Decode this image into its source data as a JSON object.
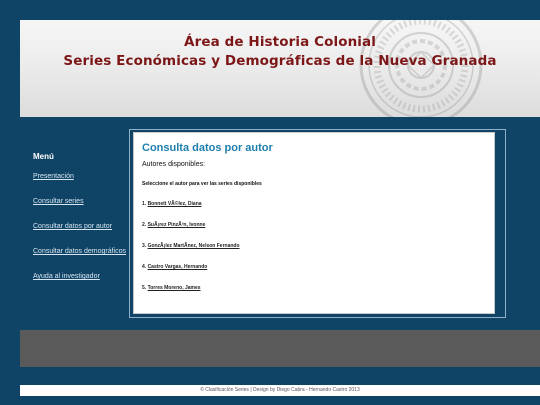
{
  "header": {
    "title_line1": "Área de Historia Colonial",
    "title_line2": "Series Económicas y Demográficas de la Nueva Granada"
  },
  "sidebar": {
    "title": "Menú",
    "items": [
      {
        "label": "Presentación"
      },
      {
        "label": "Consultar series"
      },
      {
        "label": "Consultar datos por autor"
      },
      {
        "label": "Consultar datos demográficos"
      },
      {
        "label": "Ayuda al investigador"
      }
    ]
  },
  "content": {
    "title": "Consulta datos por autor",
    "authors_label": "Autores disponibles:",
    "instruction": "Seleccione el autor para ver las series disponibles",
    "authors": [
      {
        "num": "1.",
        "name": "Bonnett VÃ©lez, Diana"
      },
      {
        "num": "2.",
        "name": "SuÃ¡rez PinzÃ³n, Ivonne"
      },
      {
        "num": "3.",
        "name": "GonzÃ¡lez MartÃ­nez, Nelson Fernando"
      },
      {
        "num": "4.",
        "name": "Castro Vargas, Hernando"
      },
      {
        "num": "5.",
        "name": "Torres Moreno, James"
      }
    ]
  },
  "footer": {
    "text": "© Clasificación Series | Design by Diego Cabra - Hernando Castro 2013"
  },
  "colors": {
    "page_background": "#0f4466",
    "title_color": "#7d1717",
    "content_title_color": "#1e7fae",
    "band_color": "#5a5a5a"
  },
  "icons": {
    "seal": "university-seal-watermark"
  }
}
